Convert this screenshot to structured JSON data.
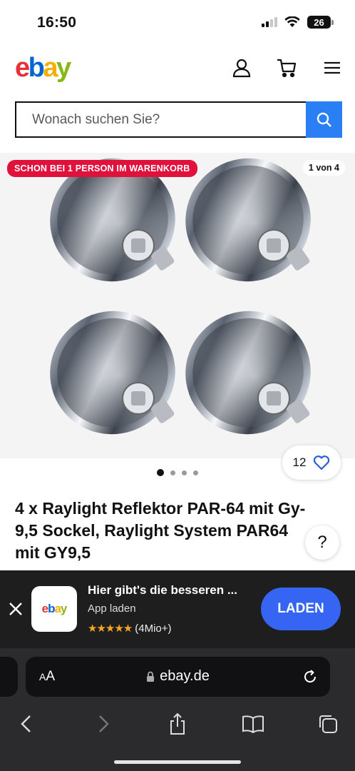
{
  "status_bar": {
    "time": "16:50",
    "battery": "26"
  },
  "header": {
    "logo": {
      "e": "e",
      "b": "b",
      "a": "a",
      "y": "y"
    }
  },
  "search": {
    "placeholder": "Wonach suchen Sie?"
  },
  "gallery": {
    "cart_badge": "SCHON BEI 1 PERSON IM WARENKORB",
    "image_counter": "1 von 4",
    "current_image": 1,
    "total_images": 4
  },
  "watch": {
    "count": "12"
  },
  "product": {
    "title": "4 x Raylight Reflektor PAR-64 mit Gy-9,5 Sockel, Raylight System PAR64 mit GY9,5"
  },
  "help": {
    "label": "?"
  },
  "app_banner": {
    "logo_text": {
      "e": "e",
      "b": "b",
      "a": "a",
      "y": "y"
    },
    "title": "Hier gibt's die besseren ...",
    "subtitle": "App laden",
    "stars": "★★★★★",
    "rating_count": "(4Mio+)",
    "button_label": "LADEN"
  },
  "browser": {
    "aa_small": "A",
    "aa_large": "A",
    "url": "ebay.de"
  },
  "colors": {
    "ebay_red": "#e53238",
    "ebay_blue": "#0064d2",
    "ebay_yellow": "#f5af02",
    "ebay_green": "#86b817",
    "search_button": "#2a7ff5",
    "badge_red": "#e0113a",
    "laden_button": "#3665f3"
  },
  "icons": [
    "signal-icon",
    "wifi-icon",
    "battery-icon",
    "user-icon",
    "cart-icon",
    "menu-icon",
    "search-icon",
    "heart-icon",
    "close-icon",
    "star-icon",
    "lock-icon",
    "reload-icon",
    "back-icon",
    "forward-icon",
    "share-icon",
    "bookmarks-icon",
    "tabs-icon"
  ]
}
